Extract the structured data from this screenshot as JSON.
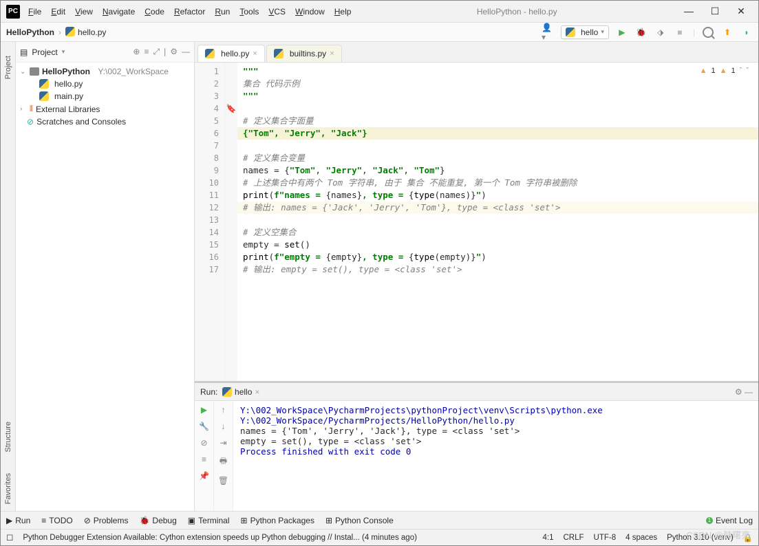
{
  "window": {
    "title": "HelloPython - hello.py",
    "logo": "PC"
  },
  "menu": [
    "File",
    "Edit",
    "View",
    "Navigate",
    "Code",
    "Refactor",
    "Run",
    "Tools",
    "VCS",
    "Window",
    "Help"
  ],
  "breadcrumb": {
    "project": "HelloPython",
    "file": "hello.py"
  },
  "run_config": "hello",
  "sidebar": {
    "header": "Project",
    "root": {
      "name": "HelloPython",
      "path": "Y:\\002_WorkSpace"
    },
    "files": [
      "hello.py",
      "main.py"
    ],
    "ext_lib": "External Libraries",
    "scratch": "Scratches and Consoles"
  },
  "tabs": [
    {
      "name": "hello.py",
      "active": true
    },
    {
      "name": "builtins.py",
      "active": false
    }
  ],
  "warnings": {
    "a": "1",
    "b": "1"
  },
  "code": [
    {
      "n": 1,
      "t": "\"\"\"",
      "cls": "str"
    },
    {
      "n": 2,
      "t": "集合 代码示例",
      "cls": "cmt"
    },
    {
      "n": 3,
      "t": "\"\"\"",
      "cls": "str"
    },
    {
      "n": 4,
      "t": "",
      "cls": ""
    },
    {
      "n": 5,
      "t": "# 定义集合字面量",
      "cls": "cmt"
    },
    {
      "n": 6,
      "t": "{\"Tom\", \"Jerry\", \"Jack\"}",
      "cls": "hl-literal str"
    },
    {
      "n": 7,
      "t": "",
      "cls": ""
    },
    {
      "n": 8,
      "t": "# 定义集合变量",
      "cls": "cmt"
    },
    {
      "n": 9,
      "raw": "names = {<span class='str'>\"Tom\"</span>, <span class='str'>\"Jerry\"</span>, <span class='str'>\"Jack\"</span>, <span class='str'>\"Tom\"</span>}"
    },
    {
      "n": 10,
      "t": "# 上述集合中有两个 Tom 字符串, 由于 集合 不能重复, 第一个 Tom 字符串被删除",
      "cls": "cmt"
    },
    {
      "n": 11,
      "raw": "<span class='fn'>print</span>(<span class='str'>f\"names = </span>{names}<span class='str'>, type = </span>{<span class='fn'>type</span>(names)}<span class='str'>\"</span>)"
    },
    {
      "n": 12,
      "t": "# 输出: names = {'Jack', 'Jerry', 'Tom'}, type = <class 'set'>",
      "cls": "cmt hl-line"
    },
    {
      "n": 13,
      "t": "",
      "cls": ""
    },
    {
      "n": 14,
      "t": "# 定义空集合",
      "cls": "cmt"
    },
    {
      "n": 15,
      "raw": "empty = <span class='fn'>set</span>()"
    },
    {
      "n": 16,
      "raw": "<span class='fn'>print</span>(<span class='str'>f\"empty = </span>{empty}<span class='str'>, type = </span>{<span class='fn'>type</span>(empty)}<span class='str'>\"</span>)"
    },
    {
      "n": 17,
      "t": "# 输出: empty = set(), type = <class 'set'>",
      "cls": "cmt"
    }
  ],
  "run": {
    "label": "Run:",
    "tab": "hello",
    "lines": [
      {
        "t": "Y:\\002_WorkSpace\\PycharmProjects\\pythonProject\\venv\\Scripts\\python.exe ",
        "cls": "path"
      },
      {
        "t": " Y:\\002_WorkSpace/PycharmProjects/HelloPython/hello.py",
        "cls": "path"
      },
      {
        "t": "names = {'Tom', 'Jerry', 'Jack'}, type = <class 'set'>",
        "cls": ""
      },
      {
        "t": "empty = set(), type = <class 'set'>",
        "cls": ""
      },
      {
        "t": "",
        "cls": ""
      },
      {
        "t": "Process finished with exit code 0",
        "cls": "path"
      }
    ]
  },
  "bottom_tabs": [
    {
      "icon": "▶",
      "label": "Run"
    },
    {
      "icon": "≡",
      "label": "TODO"
    },
    {
      "icon": "⊘",
      "label": "Problems"
    },
    {
      "icon": "🐞",
      "label": "Debug"
    },
    {
      "icon": "▣",
      "label": "Terminal"
    },
    {
      "icon": "⊞",
      "label": "Python Packages"
    },
    {
      "icon": "⊞",
      "label": "Python Console"
    }
  ],
  "event_log": "Event Log",
  "status": {
    "msg": "Python Debugger Extension Available: Cython extension speeds up Python debugging // Instal... (4 minutes ago)",
    "pos": "4:1",
    "eol": "CRLF",
    "enc": "UTF-8",
    "indent": "4 spaces",
    "sdk": "Python 3.10 (venv)"
  },
  "left_panels": [
    "Project",
    "Structure",
    "Favorites"
  ],
  "watermark": "CSDN @韩曙亮"
}
